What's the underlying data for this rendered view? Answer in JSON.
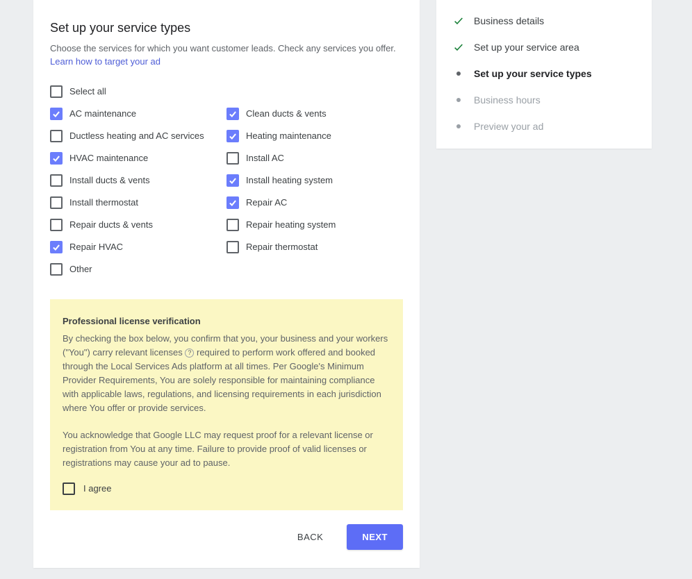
{
  "main": {
    "title": "Set up your service types",
    "subtitle_pre": "Choose the services for which you want customer leads. Check any services you offer. ",
    "subtitle_link": "Learn how to target your ad",
    "select_all": "Select all",
    "col1": [
      {
        "label": "AC maintenance",
        "checked": true
      },
      {
        "label": "Ductless heating and AC services",
        "checked": false
      },
      {
        "label": "HVAC maintenance",
        "checked": true
      },
      {
        "label": "Install ducts & vents",
        "checked": false
      },
      {
        "label": "Install thermostat",
        "checked": false
      },
      {
        "label": "Repair ducts & vents",
        "checked": false
      },
      {
        "label": "Repair HVAC",
        "checked": true
      },
      {
        "label": "Other",
        "checked": false
      }
    ],
    "col2": [
      {
        "label": "Clean ducts & vents",
        "checked": true
      },
      {
        "label": "Heating maintenance",
        "checked": true
      },
      {
        "label": "Install AC",
        "checked": false
      },
      {
        "label": "Install heating system",
        "checked": true
      },
      {
        "label": "Repair AC",
        "checked": true
      },
      {
        "label": "Repair heating system",
        "checked": false
      },
      {
        "label": "Repair thermostat",
        "checked": false
      }
    ],
    "verify": {
      "title": "Professional license verification",
      "p1a": "By checking the box below, you confirm that you, your business and your workers (\"You\") carry relevant licenses ",
      "p1b": " required to perform work offered and booked through the Local Services Ads platform at all times. Per Google's Minimum Provider Requirements, You are solely responsible for maintaining compliance with applicable laws, regulations, and licensing requirements in each jurisdiction where You offer or provide services.",
      "p2": "You acknowledge that Google LLC may request proof for a relevant license or registration from You at any time. Failure to provide proof of valid licenses or registrations may cause your ad to pause.",
      "agree": "I agree"
    },
    "buttons": {
      "back": "BACK",
      "next": "NEXT"
    }
  },
  "sidebar": {
    "steps": [
      {
        "label": "Business details",
        "state": "done"
      },
      {
        "label": "Set up your service area",
        "state": "done"
      },
      {
        "label": "Set up your service types",
        "state": "current"
      },
      {
        "label": "Business hours",
        "state": "upcoming"
      },
      {
        "label": "Preview your ad",
        "state": "upcoming"
      }
    ]
  }
}
